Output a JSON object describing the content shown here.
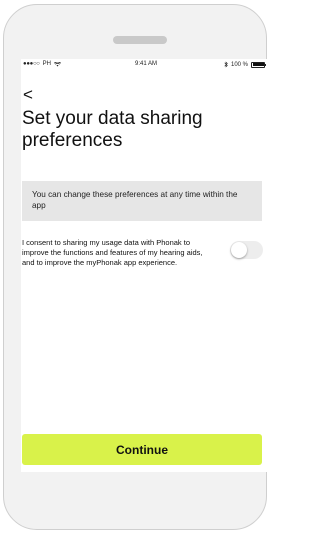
{
  "status_bar": {
    "signal": "●●●○○",
    "carrier": "PH",
    "wifi_icon": "wifi-icon",
    "time": "9:41 AM",
    "bluetooth_icon": "bluetooth-icon",
    "battery_percent": "100 %",
    "battery_level": 1.0
  },
  "nav": {
    "back": "<"
  },
  "page": {
    "title": "Set your data sharing preferences",
    "info_text": "You can change these preferences at any time within the app",
    "consent_text": "I consent to sharing my usage data with Phonak to improve the functions and features of my hearing aids, and to improve the myPhonak app experience.",
    "consent_enabled": false
  },
  "actions": {
    "continue_label": "Continue"
  },
  "colors": {
    "accent": "#d9f24a",
    "info_background": "#e6e6e6",
    "device_frame": "#f2f2f2"
  }
}
